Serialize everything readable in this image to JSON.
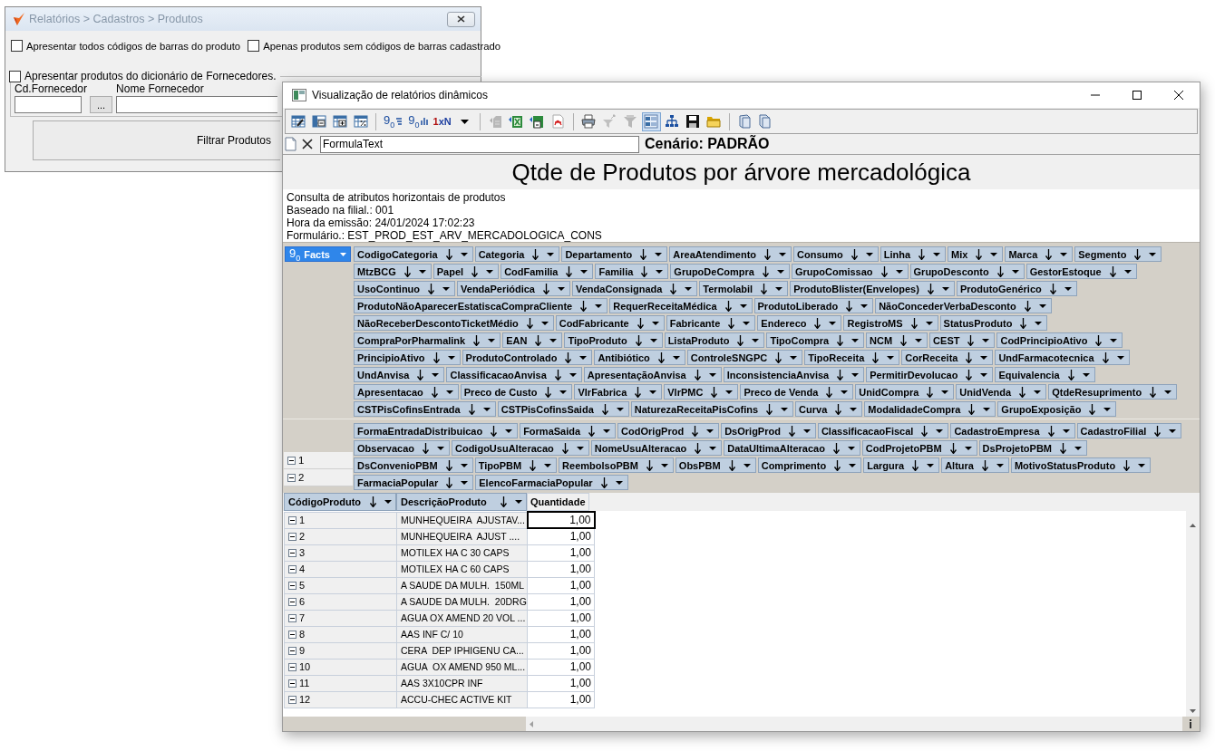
{
  "back_window": {
    "title": "Relatórios > Cadastros > Produtos",
    "options": [
      {
        "label": "Apresentar todos códigos de barras do produto",
        "checked": false
      },
      {
        "label": "Apenas produtos sem códigos de barras cadastrado",
        "checked": false
      }
    ],
    "supplier_group": {
      "label": "Apresentar produtos do dicionário de Fornecedores.",
      "checked": false,
      "code_label": "Cd.Fornecedor",
      "browse_button": "...",
      "name_label": "Nome Fornecedor"
    },
    "filter_button": "Filtrar Produtos"
  },
  "window": {
    "title": "Visualização de relatórios dinâmicos"
  },
  "toolbar": {
    "groups": [
      [
        {
          "kind": "edit",
          "pressed": false,
          "disabled": false
        },
        {
          "kind": "remove",
          "pressed": false,
          "disabled": false
        },
        {
          "kind": "add",
          "pressed": false,
          "disabled": false
        },
        {
          "kind": "percent",
          "pressed": false,
          "disabled": false
        }
      ],
      [
        {
          "kind": "decimals",
          "label": "9$_{0}$",
          "pressed": false,
          "disabled": false
        },
        {
          "kind": "thousands",
          "label": "9$_{0}$",
          "pressed": false,
          "disabled": false
        },
        {
          "kind": "text",
          "label": "1xN",
          "pressed": false,
          "disabled": false
        },
        {
          "kind": "dropdown",
          "pressed": false,
          "disabled": false
        }
      ],
      [
        {
          "kind": "export",
          "pressed": false,
          "disabled": true
        },
        {
          "kind": "excel",
          "pressed": false,
          "disabled": false
        },
        {
          "kind": "sheet",
          "pressed": false,
          "disabled": false
        },
        {
          "kind": "pdf",
          "pressed": false,
          "disabled": false
        }
      ],
      [
        {
          "kind": "print",
          "pressed": false,
          "disabled": false
        },
        {
          "kind": "filter",
          "pressed": false,
          "disabled": true
        },
        {
          "kind": "filterclear",
          "pressed": false,
          "disabled": true
        },
        {
          "kind": "layout",
          "pressed": true,
          "disabled": false
        },
        {
          "kind": "tree",
          "pressed": false,
          "disabled": false
        },
        {
          "kind": "save",
          "pressed": false,
          "disabled": false
        },
        {
          "kind": "open",
          "pressed": false,
          "disabled": false
        }
      ],
      [
        {
          "kind": "page",
          "pressed": false,
          "disabled": false
        },
        {
          "kind": "pageflip",
          "pressed": false,
          "disabled": false
        }
      ]
    ]
  },
  "formula_bar": {
    "value": "FormulaText",
    "scenario": "Cenário: PADRÃO"
  },
  "report": {
    "title": "Qtde de Produtos por árvore mercadológica",
    "info": [
      "Consulta de atributos horizontais de produtos",
      "Baseado na filial.: 001",
      "Hora da emissão: 24/01/2024 17:02:23",
      "Formulário.: EST_PROD_EST_ARV_MERCADOLOGICA_CONS"
    ]
  },
  "pivot": {
    "facts": {
      "icon_label": "9$_{0}$",
      "label": "Facts",
      "selected": true
    },
    "column_field_rows": [
      [
        "CodigoCategoria",
        "Categoria",
        "Departamento",
        "AreaAtendimento",
        "Consumo",
        "Linha",
        "Mix",
        "Marca",
        "Segmento"
      ],
      [
        "MtzBCG",
        "Papel",
        "CodFamilia",
        "Familia",
        "GrupoDeCompra",
        "GrupoComissao",
        "GrupoDesconto",
        "GestorEstoque"
      ],
      [
        "UsoContinuo",
        "VendaPeriódica",
        "VendaConsignada",
        "Termolabil",
        "ProdutoBlister(Envelopes)",
        "ProdutoGenérico"
      ],
      [
        "ProdutoNãoAparecerEstatiscaCompraCliente",
        "RequerReceitaMédica",
        "ProdutoLiberado",
        "NãoConcederVerbaDesconto"
      ],
      [
        "NãoReceberDescontoTicketMédio",
        "CodFabricante",
        "Fabricante",
        "Endereco",
        "RegistroMS",
        "StatusProduto"
      ],
      [
        "CompraPorPharmalink",
        "EAN",
        "TipoProduto",
        "ListaProduto",
        "TipoCompra",
        "NCM",
        "CEST",
        "CodPrincipioAtivo"
      ],
      [
        "PrincipioAtivo",
        "ProdutoControlado",
        "Antibiótico",
        "ControleSNGPC",
        "TipoReceita",
        "CorReceita",
        "UndFarmacotecnica"
      ],
      [
        "UndAnvisa",
        "ClassificacaoAnvisa",
        "ApresentaçãoAnvisa",
        "InconsistenciaAnvisa",
        "PermitirDevolucao",
        "Equivalencia"
      ],
      [
        "Apresentacao",
        "Preco de Custo",
        "VlrFabrica",
        "VlrPMC",
        "Preco de Venda",
        "UnidCompra",
        "UnidVenda",
        "QtdeResuprimento"
      ],
      [
        "CSTPisCofinsEntrada",
        "CSTPisCofinsSaida",
        "NaturezaReceitaPisCofins",
        "Curva",
        "ModalidadeCompra",
        "GrupoExposição"
      ]
    ],
    "row_field_rows": [
      [
        "FormaEntradaDistribuicao",
        "FormaSaida",
        "CodOrigProd",
        "DsOrigProd",
        "ClassificacaoFiscal",
        "CadastroEmpresa",
        "CadastroFilial"
      ],
      [
        "Observacao",
        "CodigoUsuAlteracao",
        "NomeUsuAlteracao",
        "DataUltimaAlteracao",
        "CodProjetoPBM",
        "DsProjetoPBM"
      ],
      [
        "DsConvenioPBM",
        "TipoPBM",
        "ReembolsoPBM",
        "ObsPBM",
        "Comprimento",
        "Largura",
        "Altura",
        "MotivoStatusProduto"
      ],
      [
        "FarmaciaPopular",
        "ElencoFarmaciaPopular"
      ]
    ],
    "row_headers": [
      {
        "label": "1",
        "expanded": true
      },
      {
        "label": "2",
        "expanded": true
      }
    ]
  },
  "grid": {
    "columns": [
      {
        "label": "CódigoProduto",
        "kind": "field"
      },
      {
        "label": "DescriçãoProduto",
        "kind": "field"
      },
      {
        "label": "Quantidade",
        "kind": "plain"
      }
    ],
    "rows": [
      {
        "code": "1",
        "description": "MUNHEQUEIRA  AJUSTAV...",
        "quantity": "1,00",
        "expanded": true,
        "selected": true
      },
      {
        "code": "2",
        "description": "MUNHEQUEIRA  AJUST ....",
        "quantity": "1,00",
        "expanded": true,
        "selected": false
      },
      {
        "code": "3",
        "description": "MOTILEX HA C 30 CAPS",
        "quantity": "1,00",
        "expanded": true,
        "selected": false
      },
      {
        "code": "4",
        "description": "MOTILEX HA C 60 CAPS",
        "quantity": "1,00",
        "expanded": true,
        "selected": false
      },
      {
        "code": "5",
        "description": "A SAUDE DA MULH.  150ML",
        "quantity": "1,00",
        "expanded": true,
        "selected": false
      },
      {
        "code": "6",
        "description": "A SAUDE DA MULH.  20DRG",
        "quantity": "1,00",
        "expanded": true,
        "selected": false
      },
      {
        "code": "7",
        "description": "AGUA OX AMEND 20 VOL ...",
        "quantity": "1,00",
        "expanded": true,
        "selected": false
      },
      {
        "code": "8",
        "description": "AAS INF C/ 10",
        "quantity": "1,00",
        "expanded": true,
        "selected": false
      },
      {
        "code": "9",
        "description": "CERA  DEP IPHIGENU CA...",
        "quantity": "1,00",
        "expanded": true,
        "selected": false
      },
      {
        "code": "10",
        "description": "AGUA  OX AMEND 950 ML...",
        "quantity": "1,00",
        "expanded": true,
        "selected": false
      },
      {
        "code": "11",
        "description": "AAS 3X10CPR INF",
        "quantity": "1,00",
        "expanded": true,
        "selected": false
      },
      {
        "code": "12",
        "description": "ACCU-CHEC ACTIVE KIT",
        "quantity": "1,00",
        "expanded": true,
        "selected": false
      }
    ]
  }
}
